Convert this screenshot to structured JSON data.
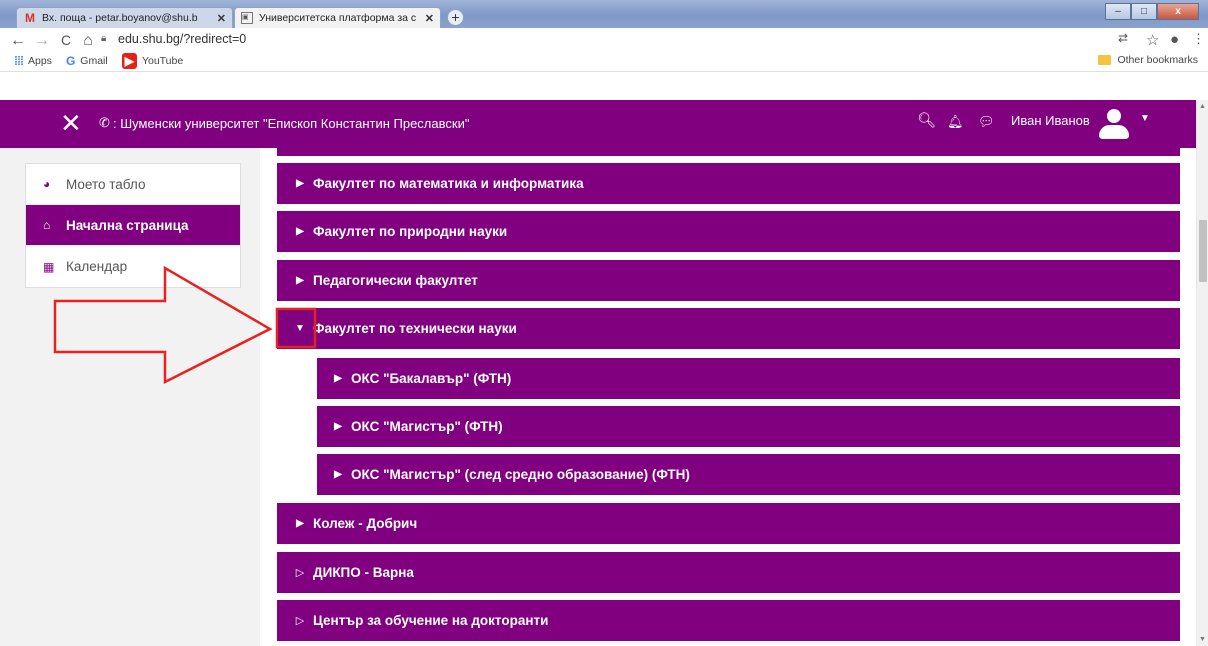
{
  "browser": {
    "tabs": [
      {
        "title": "Вх. поща - petar.boyanov@shu.b",
        "icon": "gmail-icon"
      },
      {
        "title": "Университетска платформа за с",
        "icon": "university-favicon-icon"
      }
    ],
    "new_tab": "+",
    "window_controls": {
      "minimize": "–",
      "maximize": "□",
      "close": "x"
    },
    "nav": {
      "back": "←",
      "forward": "→",
      "reload": "C",
      "home": "⌂"
    },
    "url": "edu.shu.bg/?redirect=0",
    "bookmarks": [
      {
        "label": "Apps",
        "icon": "apps-grid-icon"
      },
      {
        "label": "Gmail",
        "icon": "google-icon"
      },
      {
        "label": "YouTube",
        "icon": "youtube-icon"
      }
    ],
    "other_bookmarks": "Other bookmarks"
  },
  "header": {
    "close_symbol": "✕",
    "phone_symbol": "✆",
    "title": ": Шуменски университет \"Епископ Константин Преславски\"",
    "search_symbol": "🔍︎",
    "bell_symbol": "🔔︎",
    "chat_symbol": "💬︎",
    "user_name": "Иван Иванов",
    "caret": "▼",
    "color": "#800080"
  },
  "sidebar": {
    "items": [
      {
        "label": "Моето табло",
        "icon": "dashboard-icon",
        "symbol": "◕",
        "active": false
      },
      {
        "label": "Начална страница",
        "icon": "home-icon",
        "symbol": "⌂",
        "active": true
      },
      {
        "label": "Календар",
        "icon": "calendar-icon",
        "symbol": "▦",
        "active": false
      }
    ]
  },
  "categories": [
    {
      "label": "Факултет по математика и информатика",
      "level": 0,
      "expanded": false,
      "caret": "▶"
    },
    {
      "label": "Факултет по природни науки",
      "level": 0,
      "expanded": false,
      "caret": "▶"
    },
    {
      "label": "Педагогически факултет",
      "level": 0,
      "expanded": false,
      "caret": "▶"
    },
    {
      "label": "Факултет по технически науки",
      "level": 0,
      "expanded": true,
      "caret": "▼"
    },
    {
      "label": "ОКС \"Бакалавър\" (ФТН)",
      "level": 1,
      "expanded": false,
      "caret": "▶"
    },
    {
      "label": "ОКС \"Магистър\" (ФТН)",
      "level": 1,
      "expanded": false,
      "caret": "▶"
    },
    {
      "label": "ОКС \"Магистър\" (след средно образование) (ФТН)",
      "level": 1,
      "expanded": false,
      "caret": "▶"
    },
    {
      "label": "Колеж - Добрич",
      "level": 0,
      "expanded": false,
      "caret": "▶"
    },
    {
      "label": "ДИКПО - Варна",
      "level": 0,
      "expanded": false,
      "caret": "▷"
    },
    {
      "label": "Център за обучение на докторанти",
      "level": 0,
      "expanded": false,
      "caret": "▷"
    }
  ],
  "annotation_color": "#e8231f"
}
